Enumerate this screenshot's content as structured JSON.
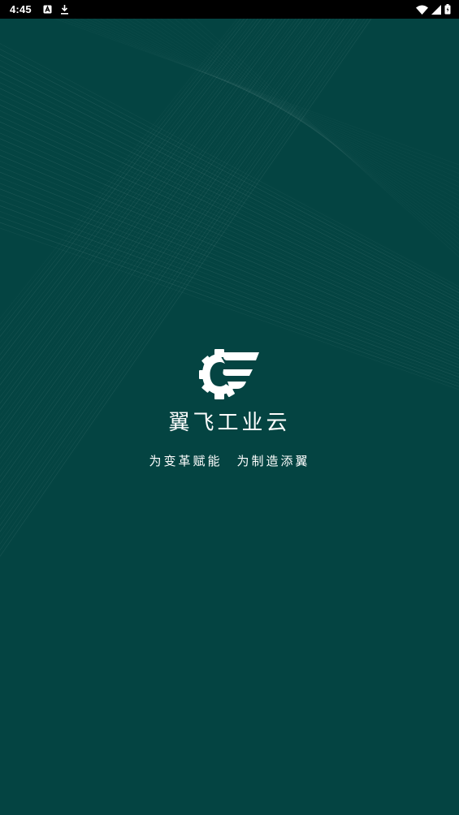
{
  "status_bar": {
    "time": "4:45",
    "icons_left": [
      "a-notification-icon",
      "download-icon"
    ],
    "icons_right": [
      "wifi-icon",
      "signal-icon",
      "battery-icon"
    ]
  },
  "splash": {
    "app_name": "翼飞工业云",
    "slogan": "为变革赋能　为制造添翼",
    "background_color": "#044442",
    "logo_color": "#ffffff",
    "logo_icon": "gear-wing-logo-icon"
  }
}
